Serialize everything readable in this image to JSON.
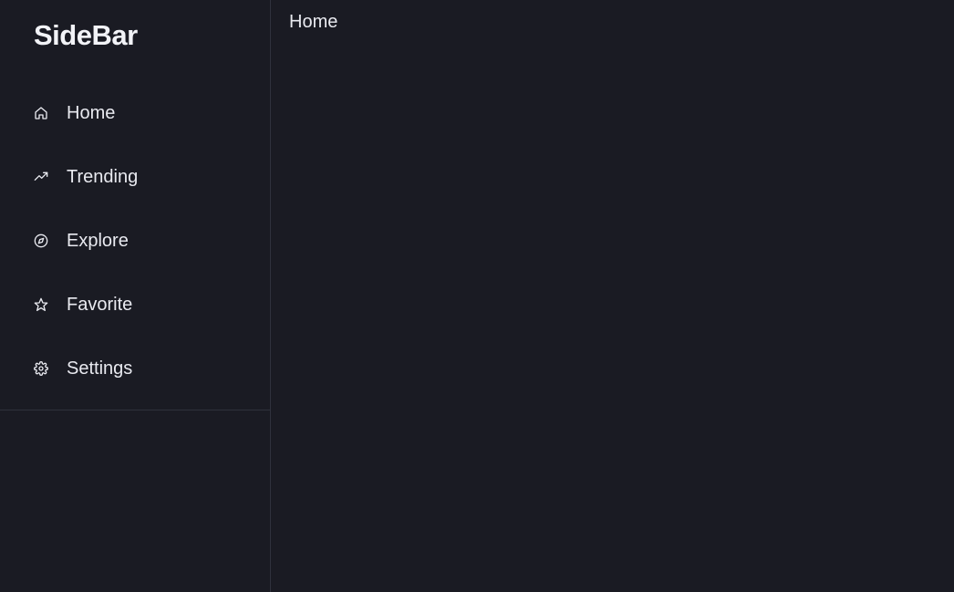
{
  "sidebar": {
    "brand": "SideBar",
    "items": [
      {
        "label": "Home",
        "icon": "home-icon"
      },
      {
        "label": "Trending",
        "icon": "trending-up-icon"
      },
      {
        "label": "Explore",
        "icon": "compass-icon"
      },
      {
        "label": "Favorite",
        "icon": "star-icon"
      },
      {
        "label": "Settings",
        "icon": "gear-icon"
      }
    ]
  },
  "main": {
    "title": "Home"
  },
  "colors": {
    "background": "#1a1b23",
    "text": "#e9eaf0",
    "border": "#2f313c"
  }
}
